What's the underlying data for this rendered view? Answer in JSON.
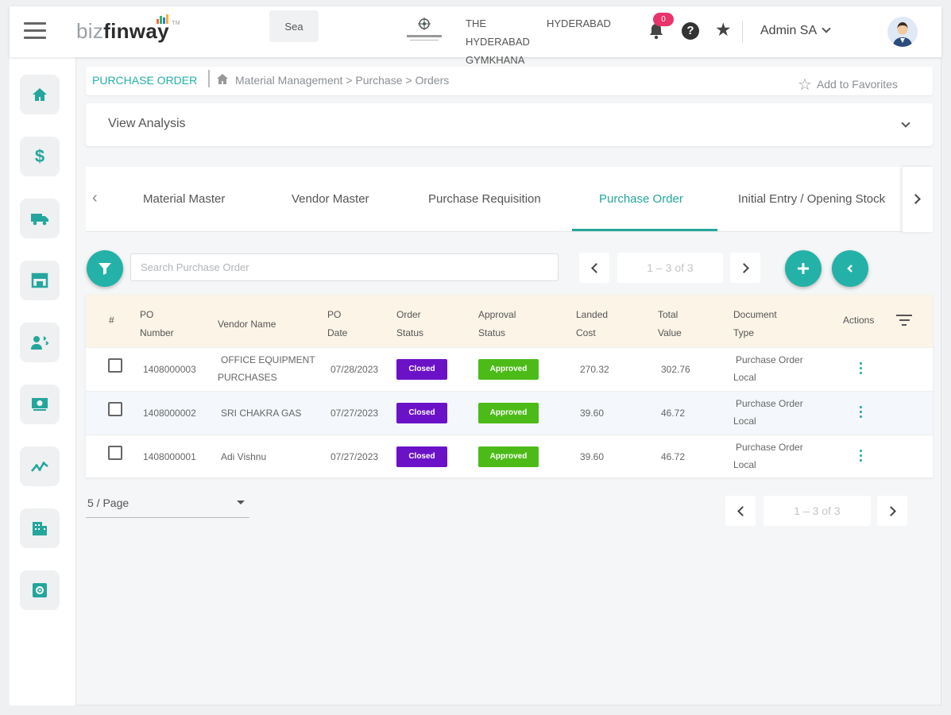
{
  "header": {
    "logo_biz": "biz",
    "logo_finway": "finway",
    "logo_tm": "TM",
    "search_value": "Sea",
    "club_name": "THE HYDERABAD GYMKHANA",
    "city": "HYDERABAD",
    "notification_count": "0",
    "help_glyph": "?",
    "user_name": "Admin SA",
    "icons": [
      "hamburger-icon",
      "bell-icon",
      "help-icon",
      "star-icon",
      "avatar-icon"
    ]
  },
  "sidebar": {
    "items": [
      {
        "name": "home",
        "icon": "home-icon"
      },
      {
        "name": "finance",
        "icon": "dollar-icon",
        "glyph": "$"
      },
      {
        "name": "logistics",
        "icon": "truck-icon"
      },
      {
        "name": "store",
        "icon": "store-icon"
      },
      {
        "name": "members",
        "icon": "members-icon"
      },
      {
        "name": "billing",
        "icon": "cash-icon"
      },
      {
        "name": "analytics",
        "icon": "chart-icon"
      },
      {
        "name": "building",
        "icon": "building-icon"
      },
      {
        "name": "settings",
        "icon": "settings-icon"
      }
    ]
  },
  "breadcrumb": {
    "title": "PURCHASE ORDER",
    "path": "Material Management > Purchase > Orders",
    "favorite_label": "Add to Favorites"
  },
  "analysis": {
    "label": "View Analysis"
  },
  "tabs": {
    "items": [
      {
        "label": "Material Master"
      },
      {
        "label": "Vendor Master"
      },
      {
        "label": "Purchase Requisition"
      },
      {
        "label": "Purchase Order"
      },
      {
        "label": "Initial Entry / Opening Stock"
      }
    ],
    "active": "Purchase Order"
  },
  "toolbar": {
    "search_placeholder": "Search Purchase Order",
    "page_info": "1 – 3 of 3"
  },
  "table": {
    "columns": {
      "index": "#",
      "po_number": [
        "PO",
        "Number"
      ],
      "vendor_name": "Vendor Name",
      "po_date": [
        "PO",
        "Date"
      ],
      "order_status": [
        "Order",
        "Status"
      ],
      "approval_status": [
        "Approval",
        "Status"
      ],
      "landed_cost": [
        "Landed",
        "Cost"
      ],
      "total_value": [
        "Total",
        "Value"
      ],
      "document_type": [
        "Document",
        "Type"
      ],
      "actions": "Actions"
    },
    "rows": [
      {
        "po_number": "1408000003",
        "vendor_line1": "OFFICE EQUIPMENT",
        "vendor_line2": "PURCHASES",
        "po_date": "07/28/2023",
        "order_status": "Closed",
        "approval_status": "Approved",
        "landed_cost": "270.32",
        "total_value": "302.76",
        "doc_line1": "Purchase Order",
        "doc_line2": "Local"
      },
      {
        "po_number": "1408000002",
        "vendor_line1": "SRI CHAKRA GAS",
        "vendor_line2": "",
        "po_date": "07/27/2023",
        "order_status": "Closed",
        "approval_status": "Approved",
        "landed_cost": "39.60",
        "total_value": "46.72",
        "doc_line1": "Purchase Order",
        "doc_line2": "Local"
      },
      {
        "po_number": "1408000001",
        "vendor_line1": "Adi Vishnu",
        "vendor_line2": "",
        "po_date": "07/27/2023",
        "order_status": "Closed",
        "approval_status": "Approved",
        "landed_cost": "39.60",
        "total_value": "46.72",
        "doc_line1": "Purchase Order",
        "doc_line2": "Local"
      }
    ]
  },
  "footer": {
    "per_page": "5 / Page",
    "page_info": "1 – 3 of 3"
  },
  "colors": {
    "accent": "#24a69d",
    "closed": "#6b12c9",
    "approved": "#4cbb17",
    "badge": "#e8336b"
  }
}
